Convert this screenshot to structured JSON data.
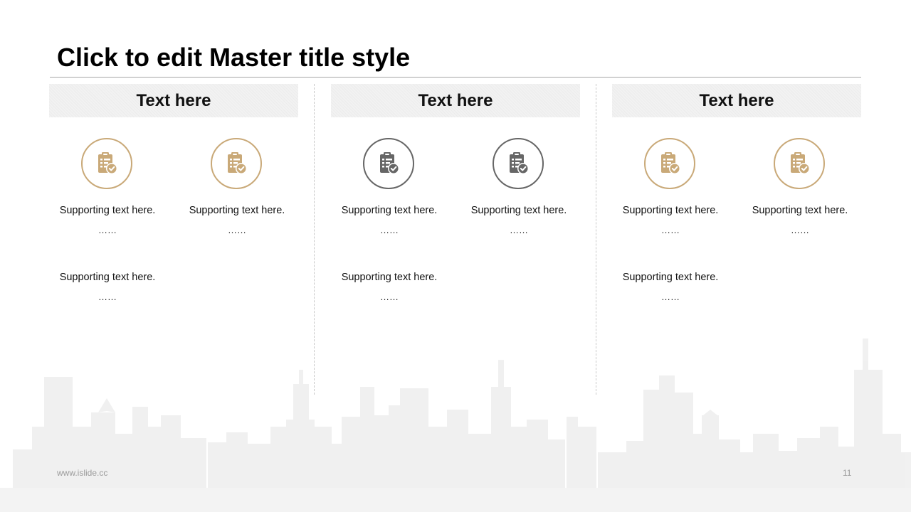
{
  "slide": {
    "title": "Click to edit Master title style",
    "footer_url": "www.islide.cc",
    "page_number": "11"
  },
  "colors": {
    "gold": "#c9a978",
    "dark": "#666666",
    "rule": "#a6a6a6"
  },
  "columns": [
    {
      "header": "Text here",
      "icon_style": "gold",
      "icon_name": "clipboard-check-icon",
      "items": [
        {
          "text": "Supporting text here.",
          "dots": "……"
        },
        {
          "text": "Supporting text here.",
          "dots": "……"
        },
        {
          "text": "Supporting text here.",
          "dots": "……"
        }
      ]
    },
    {
      "header": "Text here",
      "icon_style": "dark",
      "icon_name": "clipboard-check-icon",
      "items": [
        {
          "text": "Supporting text here.",
          "dots": "……"
        },
        {
          "text": "Supporting text here.",
          "dots": "……"
        },
        {
          "text": "Supporting text here.",
          "dots": "……"
        }
      ]
    },
    {
      "header": "Text here",
      "icon_style": "gold",
      "icon_name": "clipboard-check-icon",
      "items": [
        {
          "text": "Supporting text here.",
          "dots": "……"
        },
        {
          "text": "Supporting text here.",
          "dots": "……"
        },
        {
          "text": "Supporting text here.",
          "dots": "……"
        }
      ]
    }
  ]
}
